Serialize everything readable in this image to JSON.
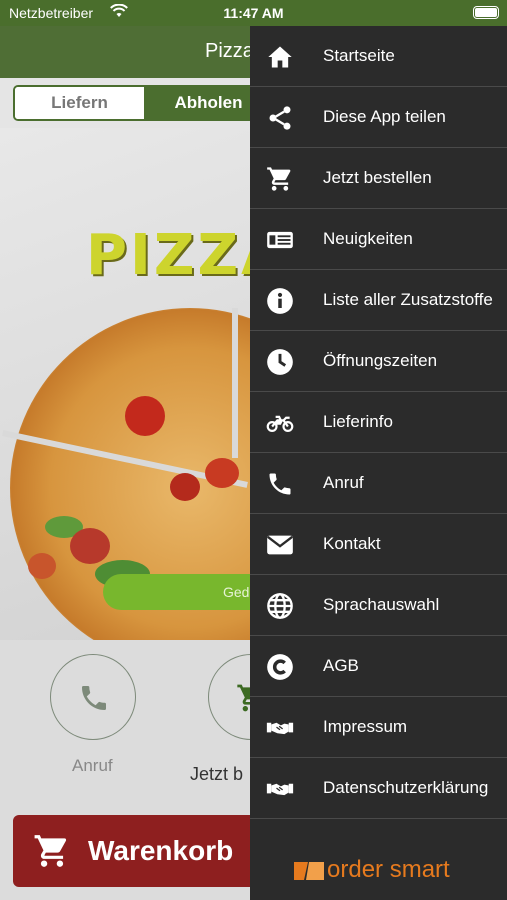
{
  "status": {
    "carrier": "Netzbetreiber",
    "time": "11:47 AM"
  },
  "appbar": {
    "title": "Pizza"
  },
  "tabs": {
    "liefern": "Liefern",
    "abholen": "Abholen"
  },
  "hero": {
    "headline": "PIZZA",
    "button_partial": "Ged"
  },
  "actions": {
    "call_label": "Anruf",
    "order_label": "Jetzt b"
  },
  "cart": {
    "label": "Warenkorb"
  },
  "drawer": {
    "items": [
      {
        "label": "Startseite",
        "icon": "home-icon"
      },
      {
        "label": "Diese App teilen",
        "icon": "share-icon"
      },
      {
        "label": "Jetzt bestellen",
        "icon": "cart-icon"
      },
      {
        "label": "Neuigkeiten",
        "icon": "news-icon"
      },
      {
        "label": "Liste aller Zusatzstoffe",
        "icon": "info-icon"
      },
      {
        "label": "Öffnungszeiten",
        "icon": "clock-icon"
      },
      {
        "label": "Lieferinfo",
        "icon": "motorcycle-icon"
      },
      {
        "label": "Anruf",
        "icon": "phone-icon"
      },
      {
        "label": "Kontakt",
        "icon": "envelope-icon"
      },
      {
        "label": "Sprachauswahl",
        "icon": "globe-icon"
      },
      {
        "label": "AGB",
        "icon": "copyright-icon"
      },
      {
        "label": "Impressum",
        "icon": "handshake-icon"
      },
      {
        "label": "Datenschutzerklärung",
        "icon": "handshake-icon"
      }
    ],
    "logo": "order smart"
  },
  "colors": {
    "primary_green": "#4f6e35",
    "drawer_bg": "#2b2b2b",
    "cart_red": "#8e1f1f",
    "logo_orange": "#e67a1e"
  }
}
